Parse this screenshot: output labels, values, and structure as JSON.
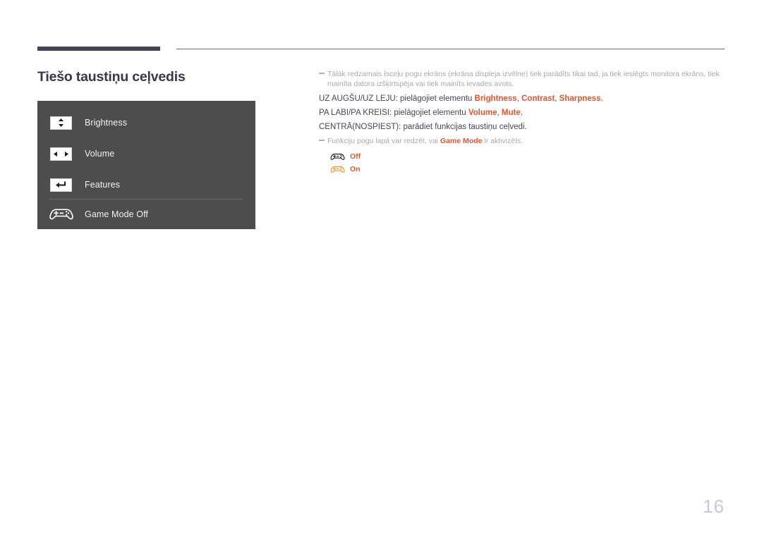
{
  "page": {
    "title": "Tiešo taustiņu ceļvedis",
    "number": "16",
    "accent_color": "#e8552d",
    "rule_color": "#474258",
    "panel_color": "#4d4d4d"
  },
  "osd_panel": {
    "name": "direct-key-guide-osd",
    "items": [
      {
        "icon": "up-down-arrows-icon",
        "label": "Brightness"
      },
      {
        "icon": "left-right-arrows-icon",
        "label": "Volume"
      },
      {
        "icon": "enter-return-arrow-icon",
        "label": "Features"
      },
      {
        "icon": "gamepad-icon",
        "label": "Game Mode Off"
      }
    ]
  },
  "notes": {
    "top": {
      "text": "Tālāk redzamais īsceļu pogu ekrāns (ekrāna displeja izvēlne) tiek parādīts tikai tad, ja tiek ieslēgts monitora ekrāns, tiek mainīta datora izšķirtspēja vai tiek mainīts ievades avots."
    },
    "bottom": {
      "prefix": "Funkciju pogu lapā var redzēt, vai ",
      "emphasis": "Game Mode",
      "suffix": " ir aktivizēts."
    }
  },
  "instructions": [
    {
      "prefix": "UZ AUGŠU/UZ LEJU: pielāgojiet elementu ",
      "terms": [
        "Brightness",
        "Contrast",
        "Sharpness"
      ],
      "separator": ", ",
      "suffix": "."
    },
    {
      "prefix": "PA LABI/PA KREISI: pielāgojiet elementu ",
      "terms": [
        "Volume",
        "Mute"
      ],
      "separator": ", ",
      "suffix": "."
    },
    {
      "prefix": "CENTRĀ(NOSPIEST): parādiet funkcijas taustiņu ceļvedi.",
      "terms": [],
      "separator": "",
      "suffix": ""
    }
  ],
  "game_mode_states": [
    {
      "icon": "gamepad-off-icon",
      "label": "Off",
      "color": "#231f20"
    },
    {
      "icon": "gamepad-on-icon",
      "label": "On",
      "color": "#f0922b"
    }
  ]
}
